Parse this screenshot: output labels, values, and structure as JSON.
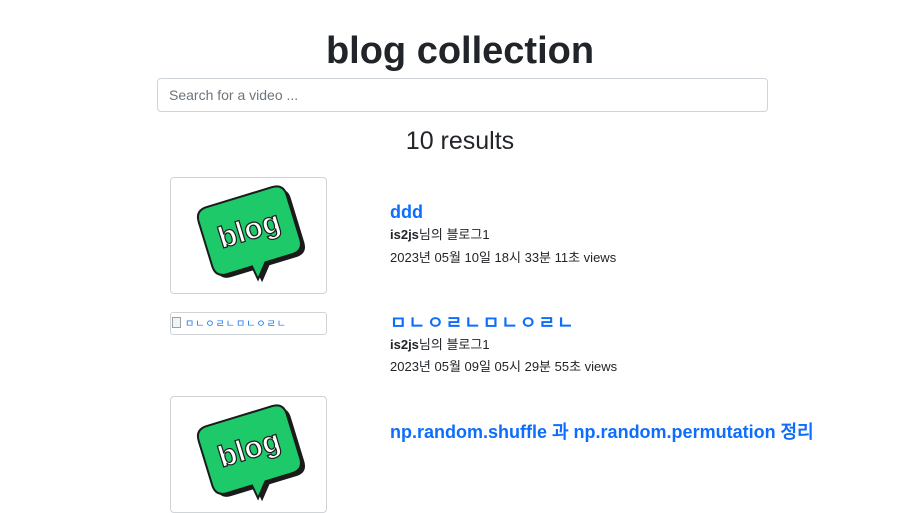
{
  "header": {
    "title": "blog collection"
  },
  "search": {
    "placeholder": "Search for a video ..."
  },
  "results": {
    "count_label": "10 results"
  },
  "colors": {
    "link": "#0d6efd",
    "logo_green": "#1ec96a",
    "logo_dark": "#1b1b1b"
  },
  "items": [
    {
      "title": "ddd",
      "author_name": "is2js",
      "author_suffix": "님의 블로그1",
      "date_views": "2023년 05월 10일 18시 33분 11초 views",
      "thumbnail": {
        "type": "logo",
        "text": "blog",
        "icon": "blog-speech-bubble-icon"
      }
    },
    {
      "title": "ㅁㄴㅇㄹㄴㅁㄴㅇㄹㄴ",
      "author_name": "is2js",
      "author_suffix": "님의 블로그1",
      "date_views": "2023년 05월 09일 05시 29분 55초 views",
      "thumbnail": {
        "type": "broken",
        "alt": "ㅁㄴㅇㄹㄴㅁㄴㅇㄹㄴ",
        "icon": "broken-image-icon"
      }
    },
    {
      "title": "np.random.shuffle 과 np.random.permutation 정리",
      "thumbnail": {
        "type": "logo",
        "text": "blog",
        "icon": "blog-speech-bubble-icon"
      }
    }
  ]
}
